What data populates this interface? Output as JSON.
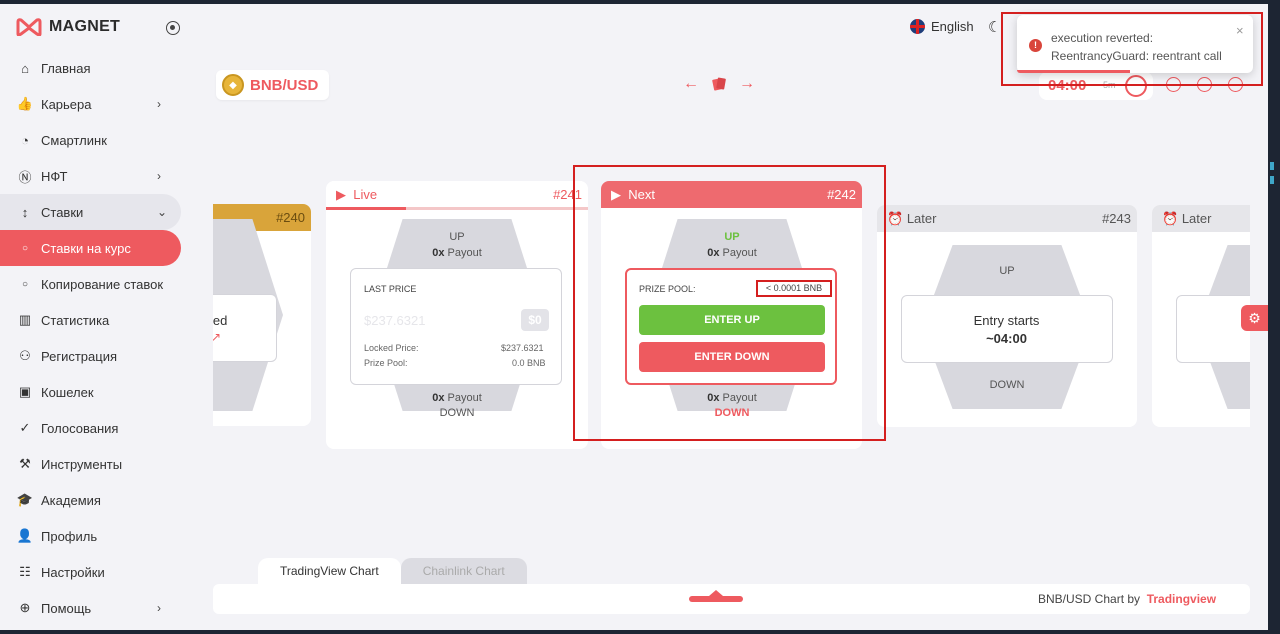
{
  "app": {
    "name": "MAGNET"
  },
  "sidebar": {
    "items": [
      {
        "label": "Главная",
        "icon": "home-icon",
        "glyph": "⌂"
      },
      {
        "label": "Карьера",
        "icon": "thumbs-up-icon",
        "glyph": "👍",
        "chevron": "›"
      },
      {
        "label": "Смартлинк",
        "icon": "glasses-icon",
        "glyph": "◔"
      },
      {
        "label": "НФТ",
        "icon": "nft-coin-icon",
        "glyph": "Ⓝ",
        "chevron": "›"
      },
      {
        "label": "Ставки",
        "icon": "updown-arrows-icon",
        "glyph": "↕",
        "chevron": "⌄"
      },
      {
        "label": "Ставки на курс",
        "icon": "circle-icon",
        "glyph": "○"
      },
      {
        "label": "Копирование ставок",
        "icon": "circle-icon",
        "glyph": "○"
      },
      {
        "label": "Статистика",
        "icon": "bar-chart-icon",
        "glyph": "▥"
      },
      {
        "label": "Регистрация",
        "icon": "user-add-icon",
        "glyph": "⚇"
      },
      {
        "label": "Кошелек",
        "icon": "wallet-icon",
        "glyph": "▣"
      },
      {
        "label": "Голосования",
        "icon": "check-icon",
        "glyph": "✓"
      },
      {
        "label": "Инструменты",
        "icon": "hammer-icon",
        "glyph": "⚒"
      },
      {
        "label": "Академия",
        "icon": "graduation-cap-icon",
        "glyph": "🎓"
      },
      {
        "label": "Профиль",
        "icon": "user-icon",
        "glyph": "👤"
      },
      {
        "label": "Настройки",
        "icon": "sliders-icon",
        "glyph": "☷"
      },
      {
        "label": "Помощь",
        "icon": "lifebuoy-icon",
        "glyph": "⊕",
        "chevron": "›"
      }
    ]
  },
  "header": {
    "pair": "BNB/USD",
    "language": "English",
    "timer": "04:00",
    "timer_unit": "5m",
    "arrow_prev": "←",
    "arrow_next": "→"
  },
  "toast": {
    "line1": "execution reverted:",
    "line2": "ReentrancyGuard: reentrant call",
    "close": "×",
    "progress": 0.48
  },
  "cards": {
    "prev": {
      "round": "#240",
      "text": "led"
    },
    "live": {
      "status": "Live",
      "round": "#241",
      "up": "UP",
      "down": "DOWN",
      "payout_up_mult": "0x",
      "payout_down_mult": "0x",
      "payout_word": "Payout",
      "last_price_label": "LAST PRICE",
      "last_price": "$237.6321",
      "change": "$0",
      "locked_label": "Locked Price:",
      "locked_value": "$237.6321",
      "pool_label": "Prize Pool:",
      "pool_value": "0.0 BNB"
    },
    "next": {
      "status": "Next",
      "round": "#242",
      "up": "UP",
      "down": "DOWN",
      "payout_up_mult": "0x",
      "payout_down_mult": "0x",
      "payout_word": "Payout",
      "pool_label": "PRIZE POOL:",
      "pool_value": "< 0.0001 BNB",
      "enter_up": "ENTER UP",
      "enter_down": "ENTER DOWN"
    },
    "later1": {
      "status": "Later",
      "round": "#243",
      "up": "UP",
      "down": "DOWN",
      "entry": "Entry starts",
      "entry_time": "~04:00"
    },
    "later2": {
      "status": "Later"
    }
  },
  "chart": {
    "tab_tradingview": "TradingView Chart",
    "tab_chainlink": "Chainlink Chart",
    "by_text": "BNB/USD Chart by",
    "by_brand": "Tradingview"
  },
  "colors": {
    "accent": "#ee5a5f",
    "green": "#6cc13f",
    "gold": "#d9a43a",
    "highlight": "#d41f1f"
  }
}
